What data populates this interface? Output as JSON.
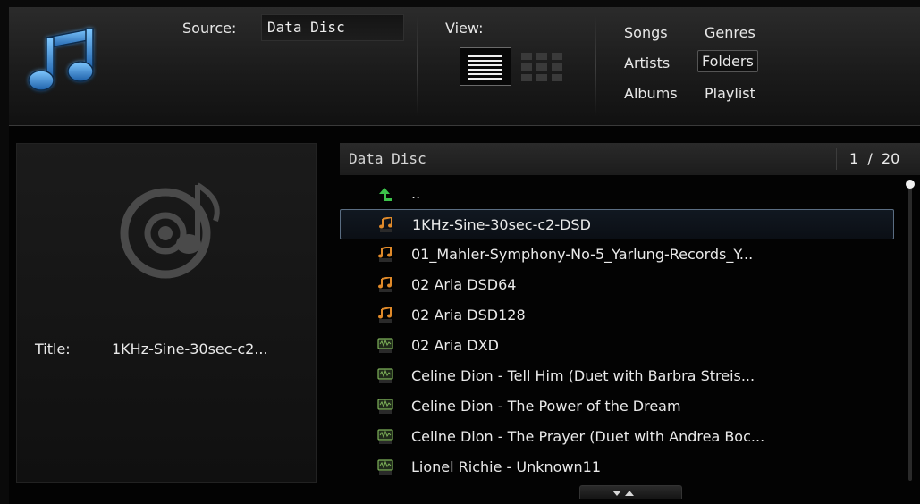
{
  "source": {
    "label": "Source:",
    "value": "Data Disc"
  },
  "view": {
    "label": "View:",
    "modes": [
      "list-view-icon",
      "grid-view-icon"
    ],
    "selected": "list"
  },
  "nav": {
    "songs": "Songs",
    "genres": "Genres",
    "artists": "Artists",
    "folders": "Folders",
    "albums": "Albums",
    "playlist": "Playlist",
    "active": "Folders"
  },
  "info": {
    "title_label": "Title:",
    "title_value": "1KHz-Sine-30sec-c2..."
  },
  "list": {
    "header_title": "Data Disc",
    "page_current": "1",
    "page_total": "20",
    "items": [
      {
        "icon": "folder-up-icon",
        "label": ".."
      },
      {
        "icon": "dsf-file-icon",
        "label": "1KHz-Sine-30sec-c2-DSD"
      },
      {
        "icon": "dsf-file-icon",
        "label": "01_Mahler-Symphony-No-5_Yarlung-Records_Y..."
      },
      {
        "icon": "dff-file-icon",
        "label": "02 Aria DSD64"
      },
      {
        "icon": "dff-file-icon",
        "label": "02 Aria DSD128"
      },
      {
        "icon": "wav-file-icon",
        "label": "02 Aria DXD"
      },
      {
        "icon": "wav-file-icon",
        "label": "Celine Dion - Tell Him (Duet with Barbra Streis..."
      },
      {
        "icon": "wav-file-icon",
        "label": "Celine Dion - The Power of the Dream"
      },
      {
        "icon": "wav-file-icon",
        "label": "Celine Dion - The Prayer (Duet with Andrea Boc..."
      },
      {
        "icon": "wav-file-icon",
        "label": "Lionel Richie - Unknown11"
      }
    ],
    "selected_index": 1
  },
  "colors": {
    "accent_blue": "#3a8fd6",
    "up_arrow_green": "#3cc24a",
    "music_orange": "#e08a2a",
    "wav_green": "#7fb35a"
  }
}
